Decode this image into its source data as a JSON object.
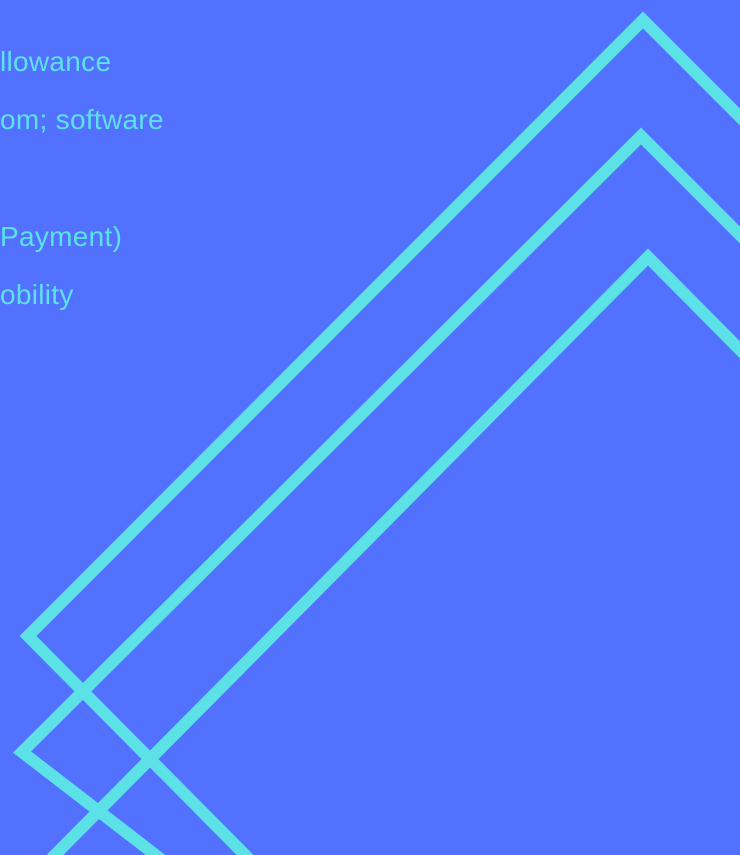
{
  "text_lines": [
    "llowance",
    "om; software",
    " Payment)",
    "obility"
  ],
  "colors": {
    "background": "#5271ff",
    "accent": "#5ce1e6"
  }
}
